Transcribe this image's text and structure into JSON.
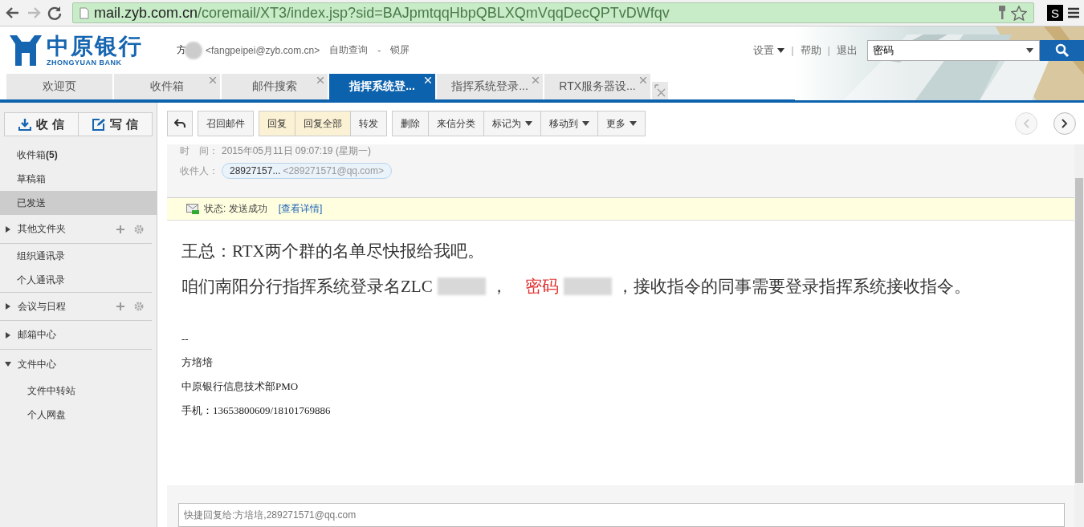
{
  "browser": {
    "url_host": "mail.zyb.com.cn",
    "url_path": "/coremail/XT3/index.jsp?sid=BAJpmtqqHbpQBLXQmVqqDecQPTvDWfqv",
    "extension_label": "S"
  },
  "header": {
    "logo_name": "中原银行",
    "logo_subtitle": "ZHONGYUAN BANK",
    "user_name": "方",
    "user_email": "<fangpeipei@zyb.com.cn>",
    "links": [
      "自助查询",
      "-",
      "锁屏"
    ],
    "menu": [
      {
        "kind": "dropdown",
        "label": "设置"
      },
      {
        "kind": "separator",
        "label": "|"
      },
      {
        "kind": "link",
        "label": "帮助"
      },
      {
        "kind": "separator",
        "label": "|"
      },
      {
        "kind": "link",
        "label": "退出"
      }
    ],
    "search": {
      "value": "密码"
    }
  },
  "tabs": [
    {
      "label": "欢迎页",
      "selected": false,
      "closable": false
    },
    {
      "label": "收件箱",
      "selected": false,
      "closable": true
    },
    {
      "label": "邮件搜索",
      "selected": false,
      "closable": true
    },
    {
      "label": "指挥系统登...",
      "selected": true,
      "closable": true
    },
    {
      "label": "指挥系统登录...",
      "selected": false,
      "closable": true
    },
    {
      "label": "RTX服务器设...",
      "selected": false,
      "closable": true
    }
  ],
  "sidebar": {
    "buttons": [
      {
        "kind": "receive",
        "label": "收 信"
      },
      {
        "kind": "compose",
        "label": "写 信"
      }
    ],
    "items": [
      {
        "kind": "folder",
        "label": "收件箱**(5)**",
        "selected": false
      },
      {
        "kind": "folder",
        "label": "草稿箱",
        "selected": false
      },
      {
        "kind": "folder",
        "label": "已发送",
        "selected": true
      },
      {
        "kind": "group",
        "label": "其他文件夹",
        "expanded": false,
        "actions": true
      },
      {
        "kind": "folder",
        "label": "组织通讯录",
        "selected": false
      },
      {
        "kind": "folder",
        "label": "个人通讯录",
        "selected": false
      },
      {
        "kind": "group",
        "label": "会议与日程",
        "expanded": false,
        "actions": true
      },
      {
        "kind": "group",
        "label": "邮箱中心",
        "expanded": false,
        "actions": false
      },
      {
        "kind": "group",
        "label": "文件中心",
        "expanded": true,
        "actions": false,
        "children": [
          {
            "label": "文件中转站",
            "selected": false
          },
          {
            "label": "个人网盘",
            "selected": false
          }
        ]
      }
    ]
  },
  "toolbar": {
    "groups": [
      [
        {
          "kind": "back",
          "highlighted": false,
          "dropdown": false
        }
      ],
      [
        {
          "kind": "button",
          "label": "召回邮件",
          "highlighted": false,
          "dropdown": false
        }
      ],
      [
        {
          "kind": "button",
          "label": "回复",
          "highlighted": true,
          "dropdown": false
        },
        {
          "kind": "button",
          "label": "回复全部",
          "highlighted": true,
          "dropdown": false
        },
        {
          "kind": "button",
          "label": "转发",
          "highlighted": false,
          "dropdown": false
        }
      ],
      [
        {
          "kind": "button",
          "label": "删除",
          "highlighted": false,
          "dropdown": false
        },
        {
          "kind": "button",
          "label": "来信分类",
          "highlighted": false,
          "dropdown": false
        },
        {
          "kind": "button",
          "label": "标记为",
          "highlighted": false,
          "dropdown": true
        },
        {
          "kind": "button",
          "label": "移动到",
          "highlighted": false,
          "dropdown": true
        },
        {
          "kind": "button",
          "label": "更多",
          "highlighted": false,
          "dropdown": true
        }
      ]
    ],
    "prev": {
      "disabled": true
    },
    "next": {
      "disabled": false
    }
  },
  "message": {
    "time_label": "时　间：",
    "time": "2015年05月11日 09:07:19 (星期一)",
    "to_label": "收件人：",
    "to_name": "28927157...",
    "to_address": "<289271571@qq.com>",
    "status_label": "状态: 发送成功",
    "status_link": "[查看详情]",
    "paragraphs": [
      [
        {
          "kind": "text",
          "text": "王总：RTX两个群的名单尽快报给我吧。"
        }
      ],
      [
        {
          "kind": "text",
          "text": "咱们南阳分行指挥系统登录名ZLC"
        },
        {
          "kind": "redacted"
        },
        {
          "kind": "text",
          "text": "，"
        },
        {
          "kind": "red",
          "text": "密码"
        },
        {
          "kind": "redacted"
        },
        {
          "kind": "text",
          "text": "，接收指令的同事需要登录指挥系统接收指令。"
        }
      ]
    ],
    "signature": [
      "--",
      "方培培",
      "中原银行信息技术部PMO",
      "手机：13653800609/18101769886"
    ]
  },
  "quick_reply": {
    "placeholder": "快捷回复给:方培培,289271571@qq.com"
  }
}
